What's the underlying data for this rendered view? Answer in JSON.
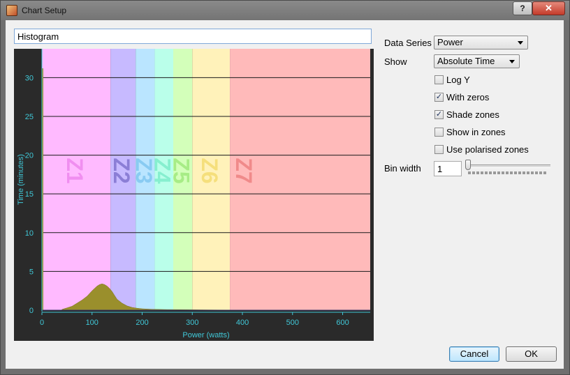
{
  "window": {
    "title": "Chart Setup",
    "help_label": "?",
    "close_label": "✕"
  },
  "chart_title_input": {
    "value": "Histogram"
  },
  "controls": {
    "data_series_label": "Data Series",
    "data_series_value": "Power",
    "show_label": "Show",
    "show_value": "Absolute Time",
    "checkboxes": [
      {
        "label": "Log Y",
        "checked": false
      },
      {
        "label": "With zeros",
        "checked": true
      },
      {
        "label": "Shade zones",
        "checked": true
      },
      {
        "label": "Show in zones",
        "checked": false
      },
      {
        "label": "Use polarised zones",
        "checked": false
      }
    ],
    "bin_width_label": "Bin width",
    "bin_width_value": "1",
    "bin_width_slider_level": 0
  },
  "buttons": {
    "cancel": "Cancel",
    "ok": "OK"
  },
  "chart_data": {
    "type": "area",
    "xlabel": "Power (watts)",
    "ylabel": "Time (minutes)",
    "xlim": [
      0,
      655
    ],
    "ylim": [
      0,
      33
    ],
    "xticks": [
      0,
      100,
      200,
      300,
      400,
      500,
      600
    ],
    "yticks": [
      0,
      5,
      10,
      15,
      20,
      25,
      30
    ],
    "grid": "horizontal",
    "zones": [
      {
        "label": "Z1",
        "from": 0,
        "to": 137,
        "color": "#ffbaff",
        "text_color": "#f08ef0"
      },
      {
        "label": "Z2",
        "from": 137,
        "to": 187,
        "color": "#c7baff",
        "text_color": "#8b7ed6"
      },
      {
        "label": "Z3",
        "from": 187,
        "to": 225,
        "color": "#bae5ff",
        "text_color": "#89cbf2"
      },
      {
        "label": "Z4",
        "from": 225,
        "to": 262,
        "color": "#baffea",
        "text_color": "#86efcf"
      },
      {
        "label": "Z5",
        "from": 262,
        "to": 300,
        "color": "#d3ffba",
        "text_color": "#a7ec86"
      },
      {
        "label": "Z6",
        "from": 300,
        "to": 375,
        "color": "#fff2ba",
        "text_color": "#f5df7c"
      },
      {
        "label": "Z7",
        "from": 375,
        "to": 655,
        "color": "#ffbaba",
        "text_color": "#f08a8a"
      }
    ],
    "series_color": "#9a8f2c",
    "zero_spike": {
      "x": 0,
      "y": 31.2
    },
    "series": [
      {
        "x": [
          40,
          50,
          60,
          70,
          80,
          90,
          100,
          105,
          110,
          115,
          120,
          125,
          130,
          135,
          140,
          145,
          150,
          160,
          170,
          180,
          190,
          200,
          220,
          250,
          300,
          350,
          400,
          450,
          500,
          600,
          650
        ],
        "values": [
          0.1,
          0.3,
          0.5,
          0.9,
          1.3,
          1.8,
          2.5,
          2.8,
          3.1,
          3.3,
          3.4,
          3.3,
          3.1,
          2.8,
          2.4,
          1.9,
          1.4,
          0.9,
          0.55,
          0.35,
          0.25,
          0.18,
          0.12,
          0.08,
          0.05,
          0.03,
          0.02,
          0.02,
          0.01,
          0.01,
          0.01
        ]
      }
    ]
  }
}
